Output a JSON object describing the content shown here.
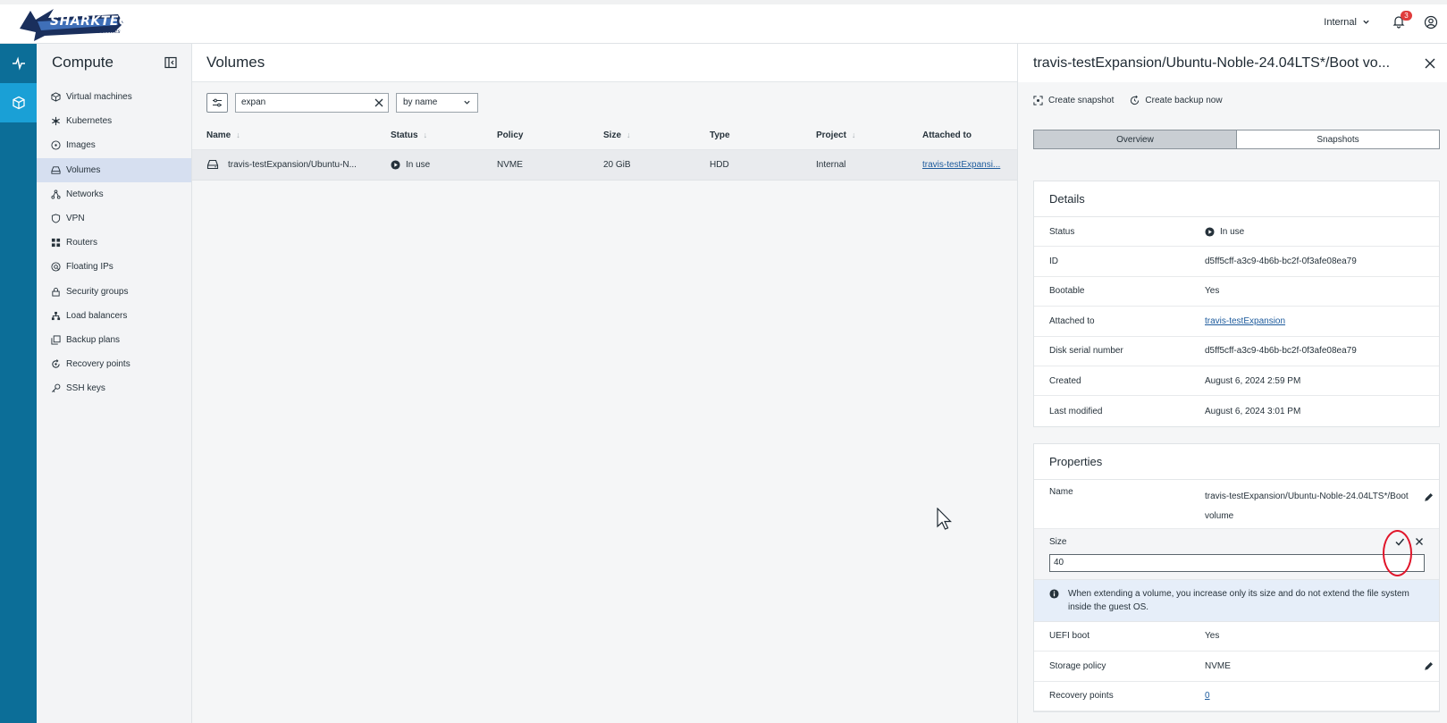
{
  "brand": {
    "logo_text": "SHARKTECH",
    "logo_sub": "Internet Services"
  },
  "topbar": {
    "project": "Internal",
    "notifications": "3"
  },
  "sidebar": {
    "title": "Compute",
    "items": [
      {
        "label": "Virtual machines",
        "icon": "cube-icon"
      },
      {
        "label": "Kubernetes",
        "icon": "kubernetes-icon"
      },
      {
        "label": "Images",
        "icon": "disc-icon"
      },
      {
        "label": "Volumes",
        "icon": "drive-icon"
      },
      {
        "label": "Networks",
        "icon": "network-icon"
      },
      {
        "label": "VPN",
        "icon": "shield-icon"
      },
      {
        "label": "Routers",
        "icon": "router-icon"
      },
      {
        "label": "Floating IPs",
        "icon": "floating-ip-icon"
      },
      {
        "label": "Security groups",
        "icon": "lock-icon"
      },
      {
        "label": "Load balancers",
        "icon": "load-balancer-icon"
      },
      {
        "label": "Backup plans",
        "icon": "backup-icon"
      },
      {
        "label": "Recovery points",
        "icon": "recovery-icon"
      },
      {
        "label": "SSH keys",
        "icon": "key-icon"
      }
    ]
  },
  "main": {
    "title": "Volumes",
    "search_value": "expan",
    "sort_value": "by name",
    "columns": [
      "Name",
      "Status",
      "Policy",
      "Size",
      "Type",
      "Project",
      "Attached to"
    ],
    "rows": [
      {
        "name": "travis-testExpansion/Ubuntu-N...",
        "status": "In use",
        "policy": "NVME",
        "size": "20 GiB",
        "type": "HDD",
        "project": "Internal",
        "attached": "travis-testExpansi..."
      }
    ]
  },
  "panel": {
    "title": "travis-testExpansion/Ubuntu-Noble-24.04LTS*/Boot vo...",
    "create_snapshot": "Create snapshot",
    "create_backup": "Create backup now",
    "tab_overview": "Overview",
    "tab_snapshots": "Snapshots",
    "details_title": "Details",
    "details": {
      "status_k": "Status",
      "status_v": "In use",
      "id_k": "ID",
      "id_v": "d5ff5cff-a3c9-4b6b-bc2f-0f3afe08ea79",
      "bootable_k": "Bootable",
      "bootable_v": "Yes",
      "attached_k": "Attached to",
      "attached_v": "travis-testExpansion",
      "serial_k": "Disk serial number",
      "serial_v": "d5ff5cff-a3c9-4b6b-bc2f-0f3afe08ea79",
      "created_k": "Created",
      "created_v": "August 6, 2024 2:59 PM",
      "modified_k": "Last modified",
      "modified_v": "August 6, 2024 3:01 PM"
    },
    "properties_title": "Properties",
    "properties": {
      "name_k": "Name",
      "name_v": "travis-testExpansion/Ubuntu-Noble-24.04LTS*/Boot volume",
      "size_k": "Size",
      "size_value": "40",
      "info": "When extending a volume, you increase only its size and do not extend the file system inside the guest OS.",
      "uefi_k": "UEFI boot",
      "uefi_v": "Yes",
      "policy_k": "Storage policy",
      "policy_v": "NVME",
      "recovery_k": "Recovery points",
      "recovery_v": "0"
    }
  }
}
